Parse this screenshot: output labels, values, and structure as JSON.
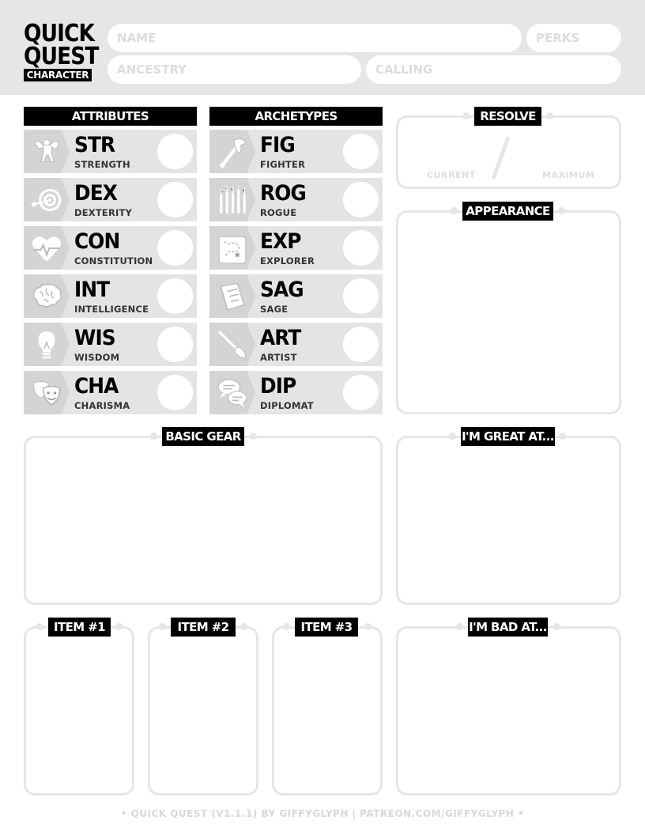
{
  "logo": {
    "line1": "QUICK",
    "line2": "QUEST",
    "line3": "CHARACTER"
  },
  "fields": {
    "name_placeholder": "NAME",
    "perks_placeholder": "PERKS",
    "ancestry_placeholder": "ANCESTRY",
    "calling_placeholder": "CALLING"
  },
  "attributes": {
    "title": "ATTRIBUTES",
    "items": [
      {
        "abbr": "STR",
        "name": "STRENGTH",
        "icon": "strongman-icon"
      },
      {
        "abbr": "DEX",
        "name": "DEXTERITY",
        "icon": "target-arrow-icon"
      },
      {
        "abbr": "CON",
        "name": "CONSTITUTION",
        "icon": "heartbeat-icon"
      },
      {
        "abbr": "INT",
        "name": "INTELLIGENCE",
        "icon": "brain-icon"
      },
      {
        "abbr": "WIS",
        "name": "WISDOM",
        "icon": "lightbulb-icon"
      },
      {
        "abbr": "CHA",
        "name": "CHARISMA",
        "icon": "theater-masks-icon"
      }
    ]
  },
  "archetypes": {
    "title": "ARCHETYPES",
    "items": [
      {
        "abbr": "FIG",
        "name": "FIGHTER",
        "icon": "battle-axe-icon"
      },
      {
        "abbr": "ROG",
        "name": "ROGUE",
        "icon": "lockpicks-icon"
      },
      {
        "abbr": "EXP",
        "name": "EXPLORER",
        "icon": "treasure-map-icon"
      },
      {
        "abbr": "SAG",
        "name": "SAGE",
        "icon": "book-icon"
      },
      {
        "abbr": "ART",
        "name": "ARTIST",
        "icon": "paintbrush-icon"
      },
      {
        "abbr": "DIP",
        "name": "DIPLOMAT",
        "icon": "speech-bubbles-icon"
      }
    ]
  },
  "resolve": {
    "title": "RESOLVE",
    "current_label": "CURRENT",
    "maximum_label": "MAXIMUM"
  },
  "sections": {
    "appearance": "APPEARANCE",
    "basic_gear": "BASIC GEAR",
    "great_at": "I'M GREAT AT...",
    "bad_at": "I'M BAD AT...",
    "item1": "ITEM #1",
    "item2": "ITEM #2",
    "item3": "ITEM #3"
  },
  "footer": "• QUICK QUEST (V1.1.1) BY GIFFYGLYPH | PATREON.COM/GIFFYGLYPH •",
  "colors": {
    "accent": "#000000",
    "panel": "#e6e6e6",
    "row": "#e4e4e4",
    "iconbox": "#d4d4d4"
  }
}
